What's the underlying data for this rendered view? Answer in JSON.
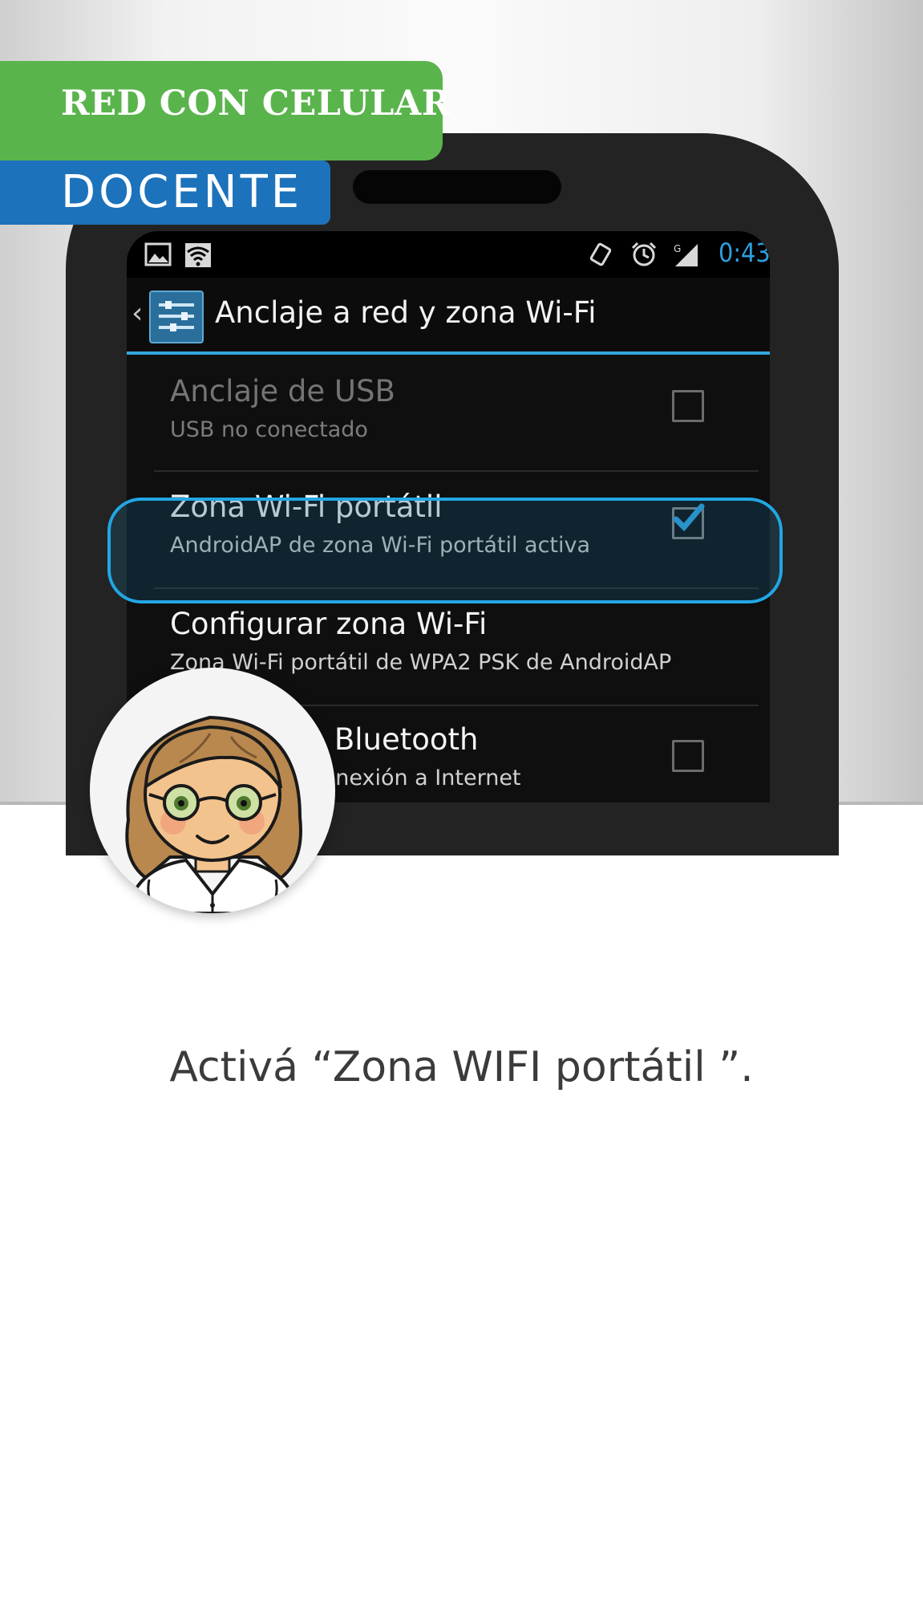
{
  "header": {
    "category_label": "RED CON CELULAR",
    "audience_label": "DOCENTE",
    "colors": {
      "category_bg": "#5ab44c",
      "audience_bg": "#1c72bb"
    }
  },
  "phone_screen": {
    "status_bar": {
      "icons_left": [
        "image-icon",
        "wifi-icon"
      ],
      "icons_right": [
        "rotate-icon",
        "alarm-icon",
        "signal-icon"
      ],
      "time": "0:43"
    },
    "action_bar": {
      "back_icon": "chevron-left-icon",
      "app_icon": "settings-sliders-icon",
      "title": "Anclaje a red y zona Wi-Fi",
      "accent_color": "#33a6de"
    },
    "settings": [
      {
        "title": "Anclaje de USB",
        "subtitle": "USB no conectado",
        "checked": false,
        "enabled": false
      },
      {
        "title": "Zona Wi-Fi portátil",
        "subtitle": "AndroidAP de zona Wi-Fi portátil activa",
        "checked": true,
        "enabled": true,
        "highlighted": true
      },
      {
        "title": "Configurar zona Wi-Fi",
        "subtitle": "Zona Wi-Fi portátil de WPA2 PSK de AndroidAP",
        "enabled": true
      },
      {
        "title": "Anclaje de Bluetooth",
        "subtitle": "Comparte la conexión a Internet",
        "checked": false,
        "enabled": true
      }
    ]
  },
  "avatar": {
    "description_icon": "teacher-avatar-icon"
  },
  "instruction": "Activá “Zona WIFI portátil ”."
}
